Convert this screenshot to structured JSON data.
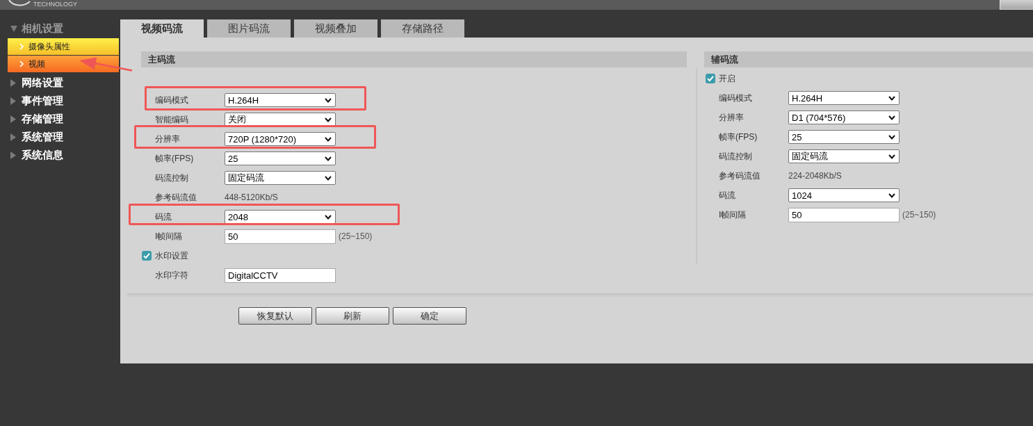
{
  "header": {
    "logo_text": "TECHNOLOGY"
  },
  "sidebar": {
    "items": [
      {
        "label": "相机设置",
        "expanded": true,
        "children": [
          {
            "label": "摄像头属性",
            "selected": false,
            "annotated": false
          },
          {
            "label": "视频",
            "selected": true,
            "annotated": true
          }
        ]
      },
      {
        "label": "网络设置",
        "expanded": false
      },
      {
        "label": "事件管理",
        "expanded": false
      },
      {
        "label": "存储管理",
        "expanded": false
      },
      {
        "label": "系统管理",
        "expanded": false
      },
      {
        "label": "系统信息",
        "expanded": false
      }
    ]
  },
  "tabs": [
    {
      "label": "视频码流",
      "selected": true
    },
    {
      "label": "图片码流",
      "selected": false
    },
    {
      "label": "视频叠加",
      "selected": false
    },
    {
      "label": "存储路径",
      "selected": false
    }
  ],
  "sections": [
    {
      "title": "主码流",
      "fields": [
        {
          "kind": "select",
          "label": "编码模式",
          "value": "H.264H",
          "highlighted": true
        },
        {
          "kind": "select",
          "label": "智能编码",
          "value": "关闭",
          "highlighted": false
        },
        {
          "kind": "select",
          "label": "分辨率",
          "value": "720P (1280*720)",
          "highlighted": true
        },
        {
          "kind": "select",
          "label": "帧率(FPS)",
          "value": "25",
          "highlighted": false
        },
        {
          "kind": "select",
          "label": "码流控制",
          "value": "固定码流",
          "highlighted": false
        },
        {
          "kind": "text",
          "label": "参考码流值",
          "value": "448-5120Kb/S",
          "highlighted": false
        },
        {
          "kind": "select",
          "label": "码流",
          "value": "2048",
          "highlighted": true
        },
        {
          "kind": "input",
          "label": "I帧间隔",
          "value": "50",
          "hint": "(25~150)",
          "highlighted": false
        },
        {
          "kind": "checkbox",
          "label": "水印设置",
          "checked": true,
          "highlighted": false
        },
        {
          "kind": "input",
          "label": "水印字符",
          "value": "DigitalCCTV",
          "highlighted": false
        }
      ]
    },
    {
      "title": "辅码流",
      "fields": [
        {
          "kind": "checkbox",
          "label": "开启",
          "checked": true
        },
        {
          "kind": "select",
          "label": "编码模式",
          "value": "H.264H"
        },
        {
          "kind": "select",
          "label": "分辨率",
          "value": "D1 (704*576)"
        },
        {
          "kind": "select",
          "label": "帧率(FPS)",
          "value": "25"
        },
        {
          "kind": "select",
          "label": "码流控制",
          "value": "固定码流"
        },
        {
          "kind": "text",
          "label": "参考码流值",
          "value": "224-2048Kb/S"
        },
        {
          "kind": "select",
          "label": "码流",
          "value": "1024"
        },
        {
          "kind": "input",
          "label": "I帧间隔",
          "value": "50",
          "hint": "(25~150)"
        }
      ]
    }
  ],
  "buttons": [
    "恢复默认",
    "刷新",
    "确定"
  ]
}
